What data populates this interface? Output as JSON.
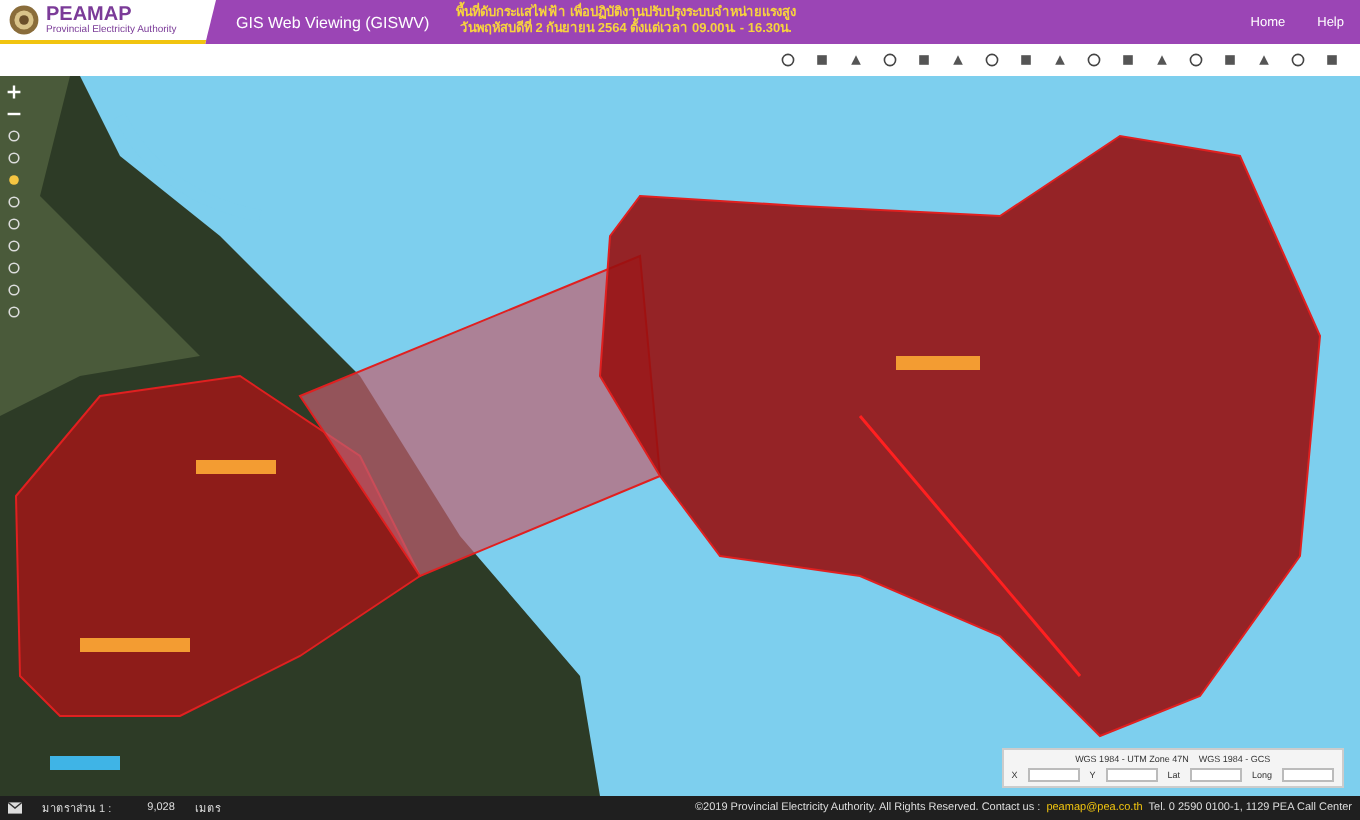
{
  "header": {
    "logo_title": "PEAMAP",
    "logo_subtitle": "Provincial Electricity Authority",
    "app_title": "GIS Web Viewing (GISWV)",
    "notice": [
      "พื้นที่ดับกระแสไฟฟ้า เพื่อปฏิบัติงานปรับปรุงระบบจำหน่ายแรงสูง",
      "วันพฤหัสบดีที่ 2 กันยายน 2564 ตั้งแต่เวลา 09.00น. - 16.30น."
    ],
    "links": [
      "Home",
      "Help"
    ]
  },
  "coordinates": {
    "projections": [
      "WGS 1984 - UTM Zone 47N",
      "WGS 1984 - GCS"
    ],
    "labels": [
      "X",
      "Y",
      "Lat",
      "Long"
    ]
  },
  "status_bar": {
    "scale_label": "มาตราส่วน 1 :",
    "scale_value": "9,028",
    "unit": "เมตร",
    "copyright": "©2019 Provincial Electricity Authority. All Rights Reserved. Contact us :",
    "email": "peamap@pea.co.th",
    "contact": "Tel. 0 2590 0100-1, 1129 PEA Call Center"
  }
}
